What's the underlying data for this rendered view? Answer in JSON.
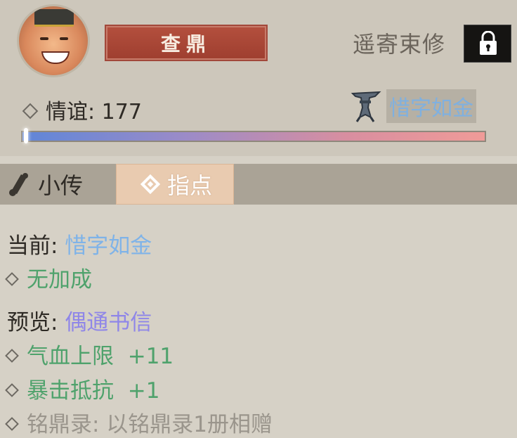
{
  "character": {
    "name": "查鼎",
    "gift_label": "遥寄束修",
    "friendship_label": "情谊",
    "friendship_value": "177",
    "friendship_progress": 0.0,
    "trait_icon": "bronze-goblet-icon",
    "current_trait": "惜字如金"
  },
  "tabs": [
    {
      "label": "小传",
      "icon": "scroll-icon",
      "active": false
    },
    {
      "label": "指点",
      "icon": "diamond-icon",
      "active": true
    }
  ],
  "details": {
    "current_label": "当前:",
    "current_value": "惜字如金",
    "current_bonus": "无加成",
    "preview_label": "预览:",
    "preview_value": "偶通书信",
    "bonuses": [
      {
        "name": "气血上限",
        "value": "+11"
      },
      {
        "name": "暴击抵抗",
        "value": "+1"
      }
    ],
    "requirement": "铭鼎录: 以铭鼎录1册相赠"
  },
  "colors": {
    "accent_blue": "#7fb3e8",
    "accent_purple": "#8f86e8",
    "bonus_green": "#4fa26c",
    "name_red": "#a8473a"
  }
}
